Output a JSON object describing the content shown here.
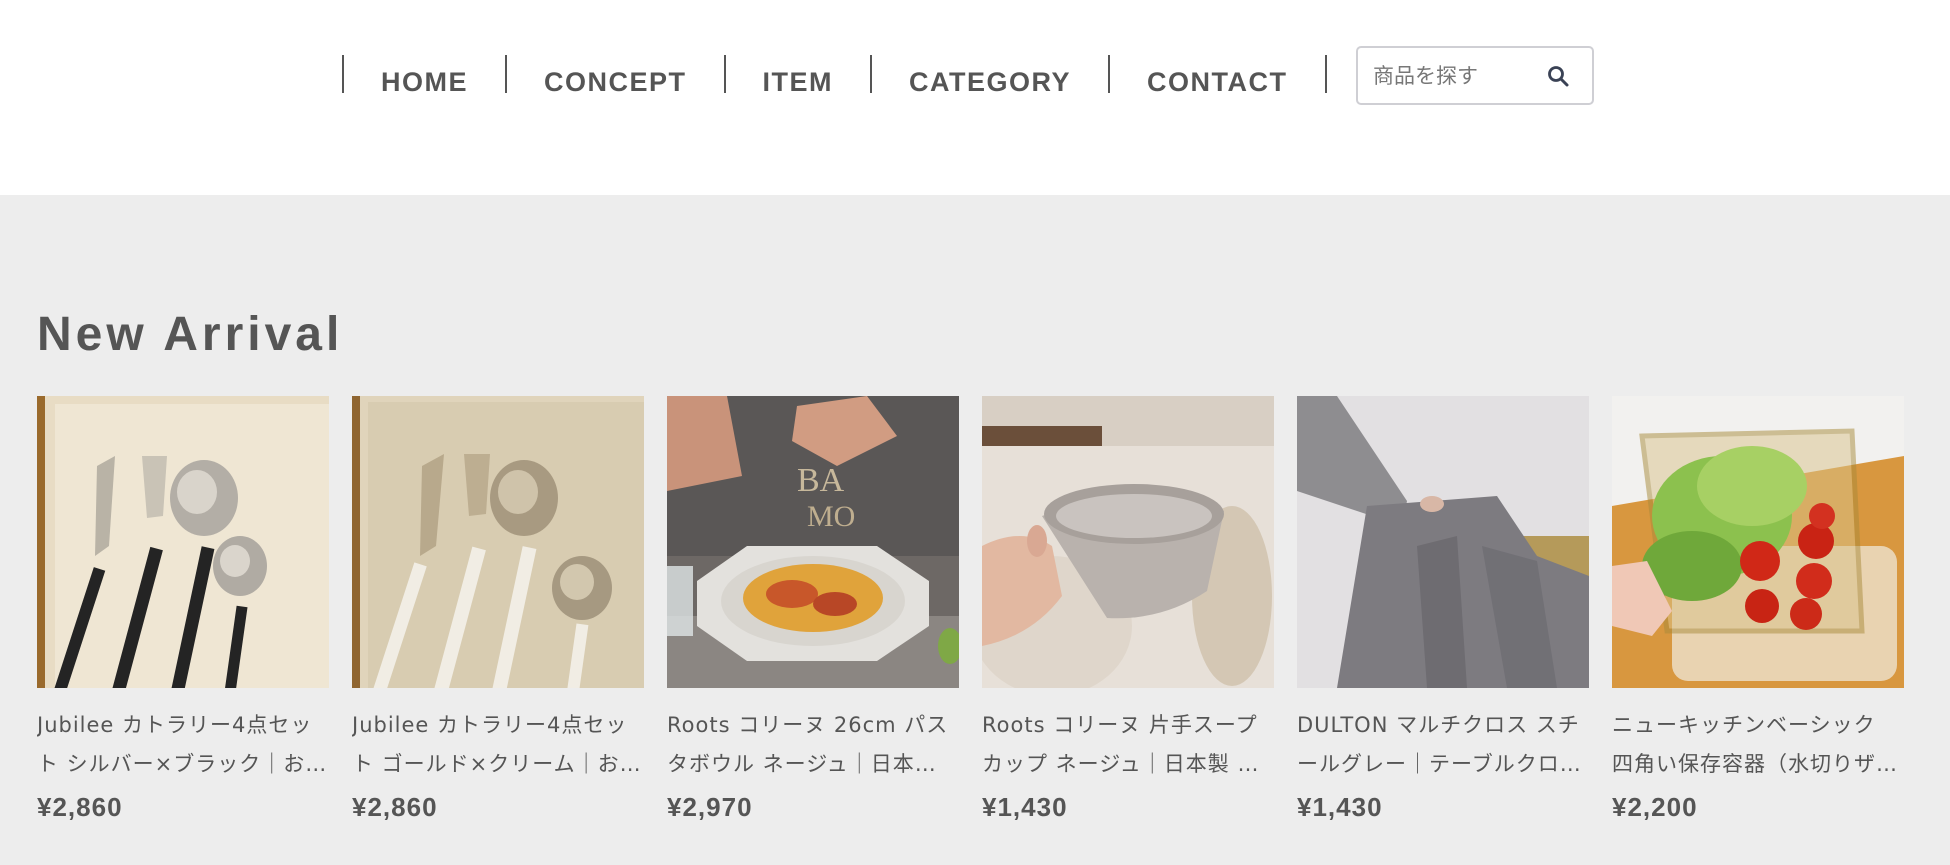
{
  "nav": {
    "items": [
      {
        "label": "HOME"
      },
      {
        "label": "CONCEPT"
      },
      {
        "label": "ITEM"
      },
      {
        "label": "CATEGORY"
      },
      {
        "label": "CONTACT"
      }
    ]
  },
  "search": {
    "placeholder": "商品を探す",
    "icon": "search-icon"
  },
  "section": {
    "title": "New Arrival"
  },
  "products": [
    {
      "name": "Jubilee カトラリー4点セット シルバー×ブラック｜お…",
      "price": "¥2,860",
      "image": "cutlery-black-photo"
    },
    {
      "name": "Jubilee カトラリー4点セット ゴールド×クリーム｜お…",
      "price": "¥2,860",
      "image": "cutlery-white-photo"
    },
    {
      "name": "Roots コリーヌ 26cm パスタボウル ネージュ｜日本…",
      "price": "¥2,970",
      "image": "pasta-bowl-photo"
    },
    {
      "name": "Roots コリーヌ 片手スープカップ ネージュ｜日本製 …",
      "price": "¥1,430",
      "image": "soup-cup-photo"
    },
    {
      "name": "DULTON マルチクロス スチールグレー｜テーブルクロ…",
      "price": "¥1,430",
      "image": "multi-cloth-photo"
    },
    {
      "name": "ニューキッチンベーシック 四角い保存容器（水切りザ…",
      "price": "¥2,200",
      "image": "container-salad-photo"
    }
  ]
}
